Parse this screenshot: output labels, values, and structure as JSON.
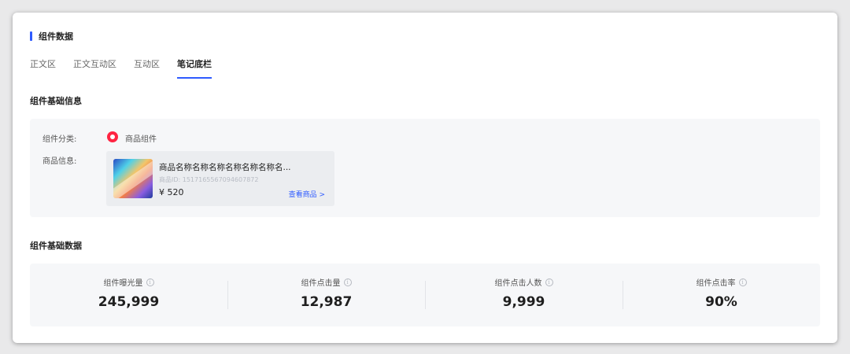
{
  "header": {
    "title": "组件数据"
  },
  "tabs": [
    {
      "label": "正文区"
    },
    {
      "label": "正文互动区"
    },
    {
      "label": "互动区"
    },
    {
      "label": "笔记底栏"
    }
  ],
  "basic_info": {
    "title": "组件基础信息",
    "category_label": "组件分类:",
    "category_value": "商品组件",
    "product_label": "商品信息:",
    "product": {
      "name": "商品名称名称名称名称名称名称名...",
      "id": "商品ID: 1517165567094607872",
      "price": "¥ 520",
      "view_link": "查看商品 >"
    }
  },
  "basic_data": {
    "title": "组件基础数据",
    "stats": [
      {
        "label": "组件曝光量",
        "value": "245,999"
      },
      {
        "label": "组件点击量",
        "value": "12,987"
      },
      {
        "label": "组件点击人数",
        "value": "9,999"
      },
      {
        "label": "组件点击率",
        "value": "90%"
      }
    ]
  },
  "colors": {
    "accent": "#2e5bff",
    "brand_red": "#ff2442"
  },
  "icons": {
    "info": "info-icon",
    "category": "xiaohongshu-product-icon"
  }
}
